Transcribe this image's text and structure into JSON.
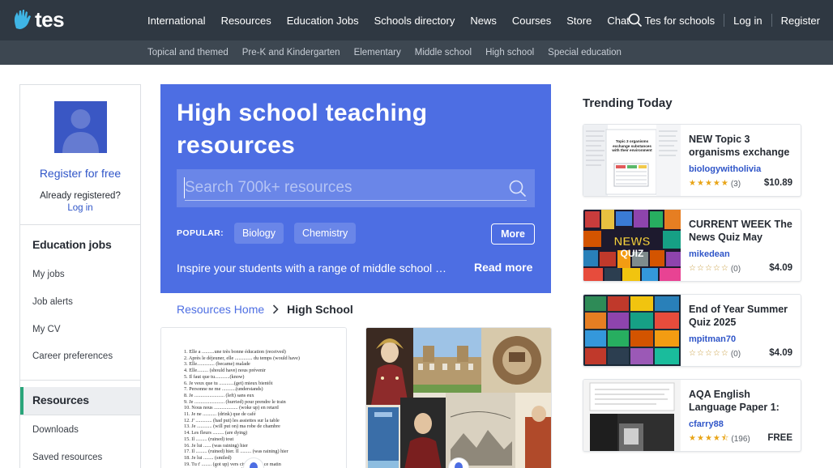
{
  "brand": {
    "name": "tes",
    "accent": "#4d6ee3",
    "nav_bg": "#2f3842"
  },
  "topnav": {
    "links": [
      "International",
      "Resources",
      "Education Jobs",
      "Schools directory",
      "News",
      "Courses",
      "Store",
      "Chat"
    ],
    "tes_for_schools": "Tes for schools",
    "login": "Log in",
    "register": "Register"
  },
  "subnav": {
    "links": [
      "Topical and themed",
      "Pre-K and Kindergarten",
      "Elementary",
      "Middle school",
      "High school",
      "Special education"
    ]
  },
  "sidebar": {
    "register_free": "Register for free",
    "already_registered": "Already registered?",
    "login": "Log in",
    "jobs_heading": "Education jobs",
    "jobs_items": [
      "My jobs",
      "Job alerts",
      "My CV",
      "Career preferences"
    ],
    "resources_heading": "Resources",
    "resources_items": [
      "Downloads",
      "Saved resources"
    ]
  },
  "hero": {
    "title": "High school teaching resources",
    "search_placeholder": "Search 700k+ resources",
    "popular_label": "POPULAR:",
    "popular_chips": [
      "Biology",
      "Chemistry"
    ],
    "more_label": "More",
    "description": "Inspire your students with a range of middle school …",
    "read_more": "Read more"
  },
  "breadcrumb": {
    "home": "Resources Home",
    "current": "High School"
  },
  "worksheet_lines": [
    "1. Elle a ..........une très bonne éducation (received)",
    "2. Après le déjeuner,  elle .............. du temps (would have)",
    "3. Elle.............. (became) malade",
    "4. Elle......... (should have) nous prévenir",
    "5. Il faut que tu............(know)",
    "6. Je veux que tu ............(get) mieux bientôt",
    "7. Personne ne me ...........(understands)",
    "8. Je ........................ (left) sans eux",
    "9. Je ........................ (hurried) pour prendre le train",
    "10. Nous nous ................... (woke up) en retard",
    "11. Je ne ........... (drink) que de café",
    "12. J' ............. (had put) les assiettes sur la table",
    "13. Je ............ (will put on)  ma robe de chambre",
    "14. Les fleurs ......... (are dying)",
    "15. Il ......... (ruined) tout",
    "16. Je lui ...... (was raining) hier",
    "17. Il ......... (ruined) hier. Il ......... (was raining) hier",
    "18. Je lui ........ (smiled)",
    "19. Tu t' ........ (got up) vers cinq heures ce matin",
    "20. Je crois qu'ils ........ (crank) trop de vin"
  ],
  "trending": {
    "heading": "Trending Today",
    "items": [
      {
        "title": "NEW Topic 3 organisms exchange",
        "author": "biologywitholivia",
        "rating": 5,
        "count": "(3)",
        "price": "$10.89"
      },
      {
        "title": "CURRENT WEEK The News Quiz May",
        "author": "mikedean",
        "rating": 0,
        "count": "(0)",
        "price": "$4.09"
      },
      {
        "title": "End of Year Summer Quiz 2025",
        "author": "mpitman70",
        "rating": 0,
        "count": "(0)",
        "price": "$4.09"
      },
      {
        "title": "AQA English Language Paper 1:",
        "author": "cfarry88",
        "rating": 4.5,
        "count": "(196)",
        "price": "FREE"
      }
    ]
  },
  "thumb_texts": {
    "topic3": "Topic 3 organisms exchange substances with their environment"
  }
}
